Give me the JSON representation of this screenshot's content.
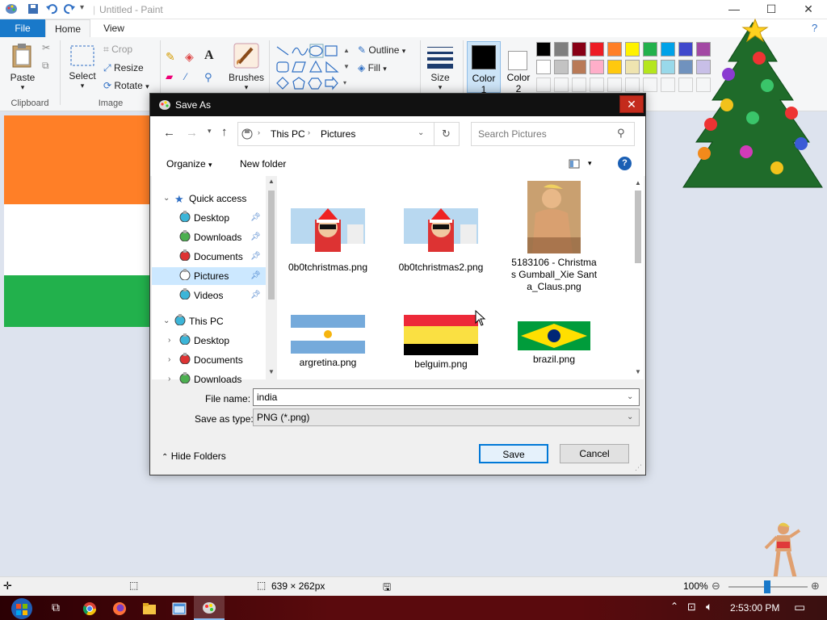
{
  "app": {
    "title": "Untitled - Paint",
    "qat_icons": [
      "paint-logo-icon",
      "save-icon",
      "undo-icon",
      "redo-icon",
      "customize-qat-icon"
    ]
  },
  "ribbon": {
    "tabs": [
      "File",
      "Home",
      "View"
    ],
    "groups": {
      "clipboard": {
        "label": "Clipboard",
        "paste": "Paste"
      },
      "image": {
        "label": "Image",
        "select": "Select",
        "crop": "Crop",
        "resize": "Resize",
        "rotate": "Rotate"
      },
      "tools": {
        "brushes": "Brushes"
      },
      "shapes": {
        "outline": "Outline",
        "fill": "Fill"
      },
      "size": {
        "label": "Size"
      },
      "colors": {
        "color1": "Color",
        "color1_num": "1",
        "color2": "Color",
        "color2_num": "2",
        "palette_row1": [
          "#000000",
          "#7f7f7f",
          "#880015",
          "#ed1c24",
          "#ff7f27",
          "#fff200",
          "#22b14c",
          "#00a2e8",
          "#3f48cc",
          "#a349a4"
        ],
        "palette_row2": [
          "#ffffff",
          "#c3c3c3",
          "#b97a57",
          "#ffaec9",
          "#ffc90e",
          "#efe4b0",
          "#b5e61d",
          "#99d9ea",
          "#7092be",
          "#c8bfe7"
        ],
        "color1_value": "#000000",
        "color2_value": "#ffffff"
      }
    }
  },
  "canvas": {
    "flag_colors": [
      "#ff7f27",
      "#ffffff",
      "#22b14c"
    ]
  },
  "status": {
    "dimensions": "639 × 262px",
    "zoom": "100%"
  },
  "taskbar": {
    "time": "2:53:00 PM"
  },
  "dialog": {
    "title": "Save As",
    "breadcrumb": [
      "This PC",
      "Pictures"
    ],
    "search_placeholder": "Search Pictures",
    "organize": "Organize",
    "new_folder": "New folder",
    "nav": {
      "quick_access": "Quick access",
      "quick_items": [
        "Desktop",
        "Downloads",
        "Documents",
        "Pictures",
        "Videos"
      ],
      "this_pc": "This PC",
      "pc_items": [
        "Desktop",
        "Documents",
        "Downloads"
      ]
    },
    "files": [
      {
        "name": "0b0tchristmas.png",
        "kind": "xmas"
      },
      {
        "name": "0b0tchristmas2.png",
        "kind": "xmas"
      },
      {
        "name": "5183106 - Christmas Gumball_Xie Santa_Claus.png",
        "kind": "art"
      },
      {
        "name": "argretina.png",
        "kind": "argentina"
      },
      {
        "name": "belguim.png",
        "kind": "belgium"
      },
      {
        "name": "brazil.png",
        "kind": "brazil"
      }
    ],
    "file_name_label": "File name:",
    "file_name_value": "india",
    "save_type_label": "Save as type:",
    "save_type_value": "PNG (*.png)",
    "hide_folders": "Hide Folders",
    "save": "Save",
    "cancel": "Cancel"
  }
}
